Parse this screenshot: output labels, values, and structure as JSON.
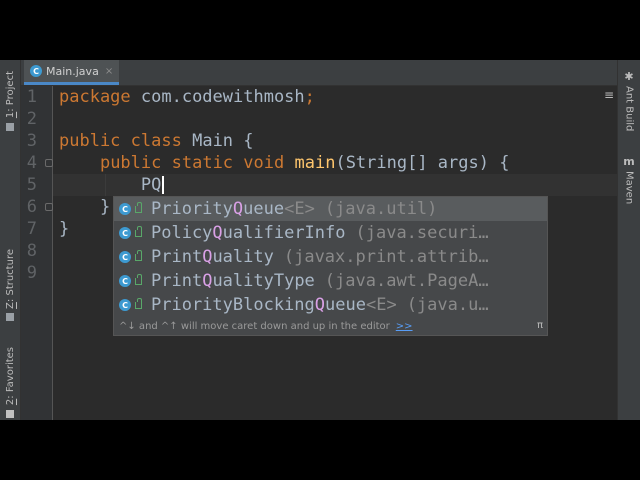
{
  "editor_tab": {
    "label": "Main.java",
    "icon": "class-c-icon",
    "close": "×"
  },
  "left_tool_windows": [
    {
      "number": "1",
      "label": ": Project"
    },
    {
      "number": "Z",
      "label": ": Structure"
    },
    {
      "number": "2",
      "label": ": Favorites"
    }
  ],
  "right_tool_windows": [
    {
      "icon": "ant-icon",
      "label": "Ant Build"
    },
    {
      "icon": "maven-icon",
      "glyph": "m",
      "label": "Maven"
    }
  ],
  "gutter": {
    "line_numbers": [
      "1",
      "2",
      "3",
      "4",
      "5",
      "6",
      "7",
      "8",
      "9"
    ]
  },
  "code": {
    "line1_kw": "package",
    "line1_rest": " com.codewithmosh",
    "line1_semi": ";",
    "line3_kw1": "public",
    "line3_kw2": "class",
    "line3_rest": " Main {",
    "line4_indent": "    ",
    "line4_kw1": "public",
    "line4_kw2": "static",
    "line4_kw3": "void",
    "line4_fn": "main",
    "line4_rest": "(String[] args) {",
    "line5_indent": "        ",
    "line5_typed": "PQ",
    "line6_indent": "    ",
    "line6_text": "}",
    "line7_text": "}"
  },
  "completion": {
    "items": [
      {
        "p1": "Priority",
        "h1": "Q",
        "p2": "ueue",
        "generic": "<E>",
        "package": "(java.util)"
      },
      {
        "p1": "Policy",
        "h1": "Q",
        "p2": "ualifierInfo",
        "generic": "",
        "package": "(java.securi…"
      },
      {
        "p1": "Print",
        "h1": "Q",
        "p2": "uality",
        "generic": "",
        "package": "(javax.print.attrib…"
      },
      {
        "p1": "Print",
        "h1": "Q",
        "p2": "ualityType",
        "generic": "",
        "package": "(java.awt.PageA…"
      },
      {
        "p1": "PriorityBlocking",
        "h1": "Q",
        "p2": "ueue",
        "generic": "<E>",
        "package": "(java.u…"
      }
    ],
    "selected_index": 0,
    "footer_text": "^↓ and ^↑ will move caret down and up in the editor",
    "footer_link": ">>",
    "footer_pi": "π"
  },
  "colors": {
    "keyword": "#cc7832",
    "method": "#ffc66d",
    "text": "#a9b7c6",
    "match_highlight": "#d9a0e6",
    "class_icon": "#3d9ad1"
  }
}
